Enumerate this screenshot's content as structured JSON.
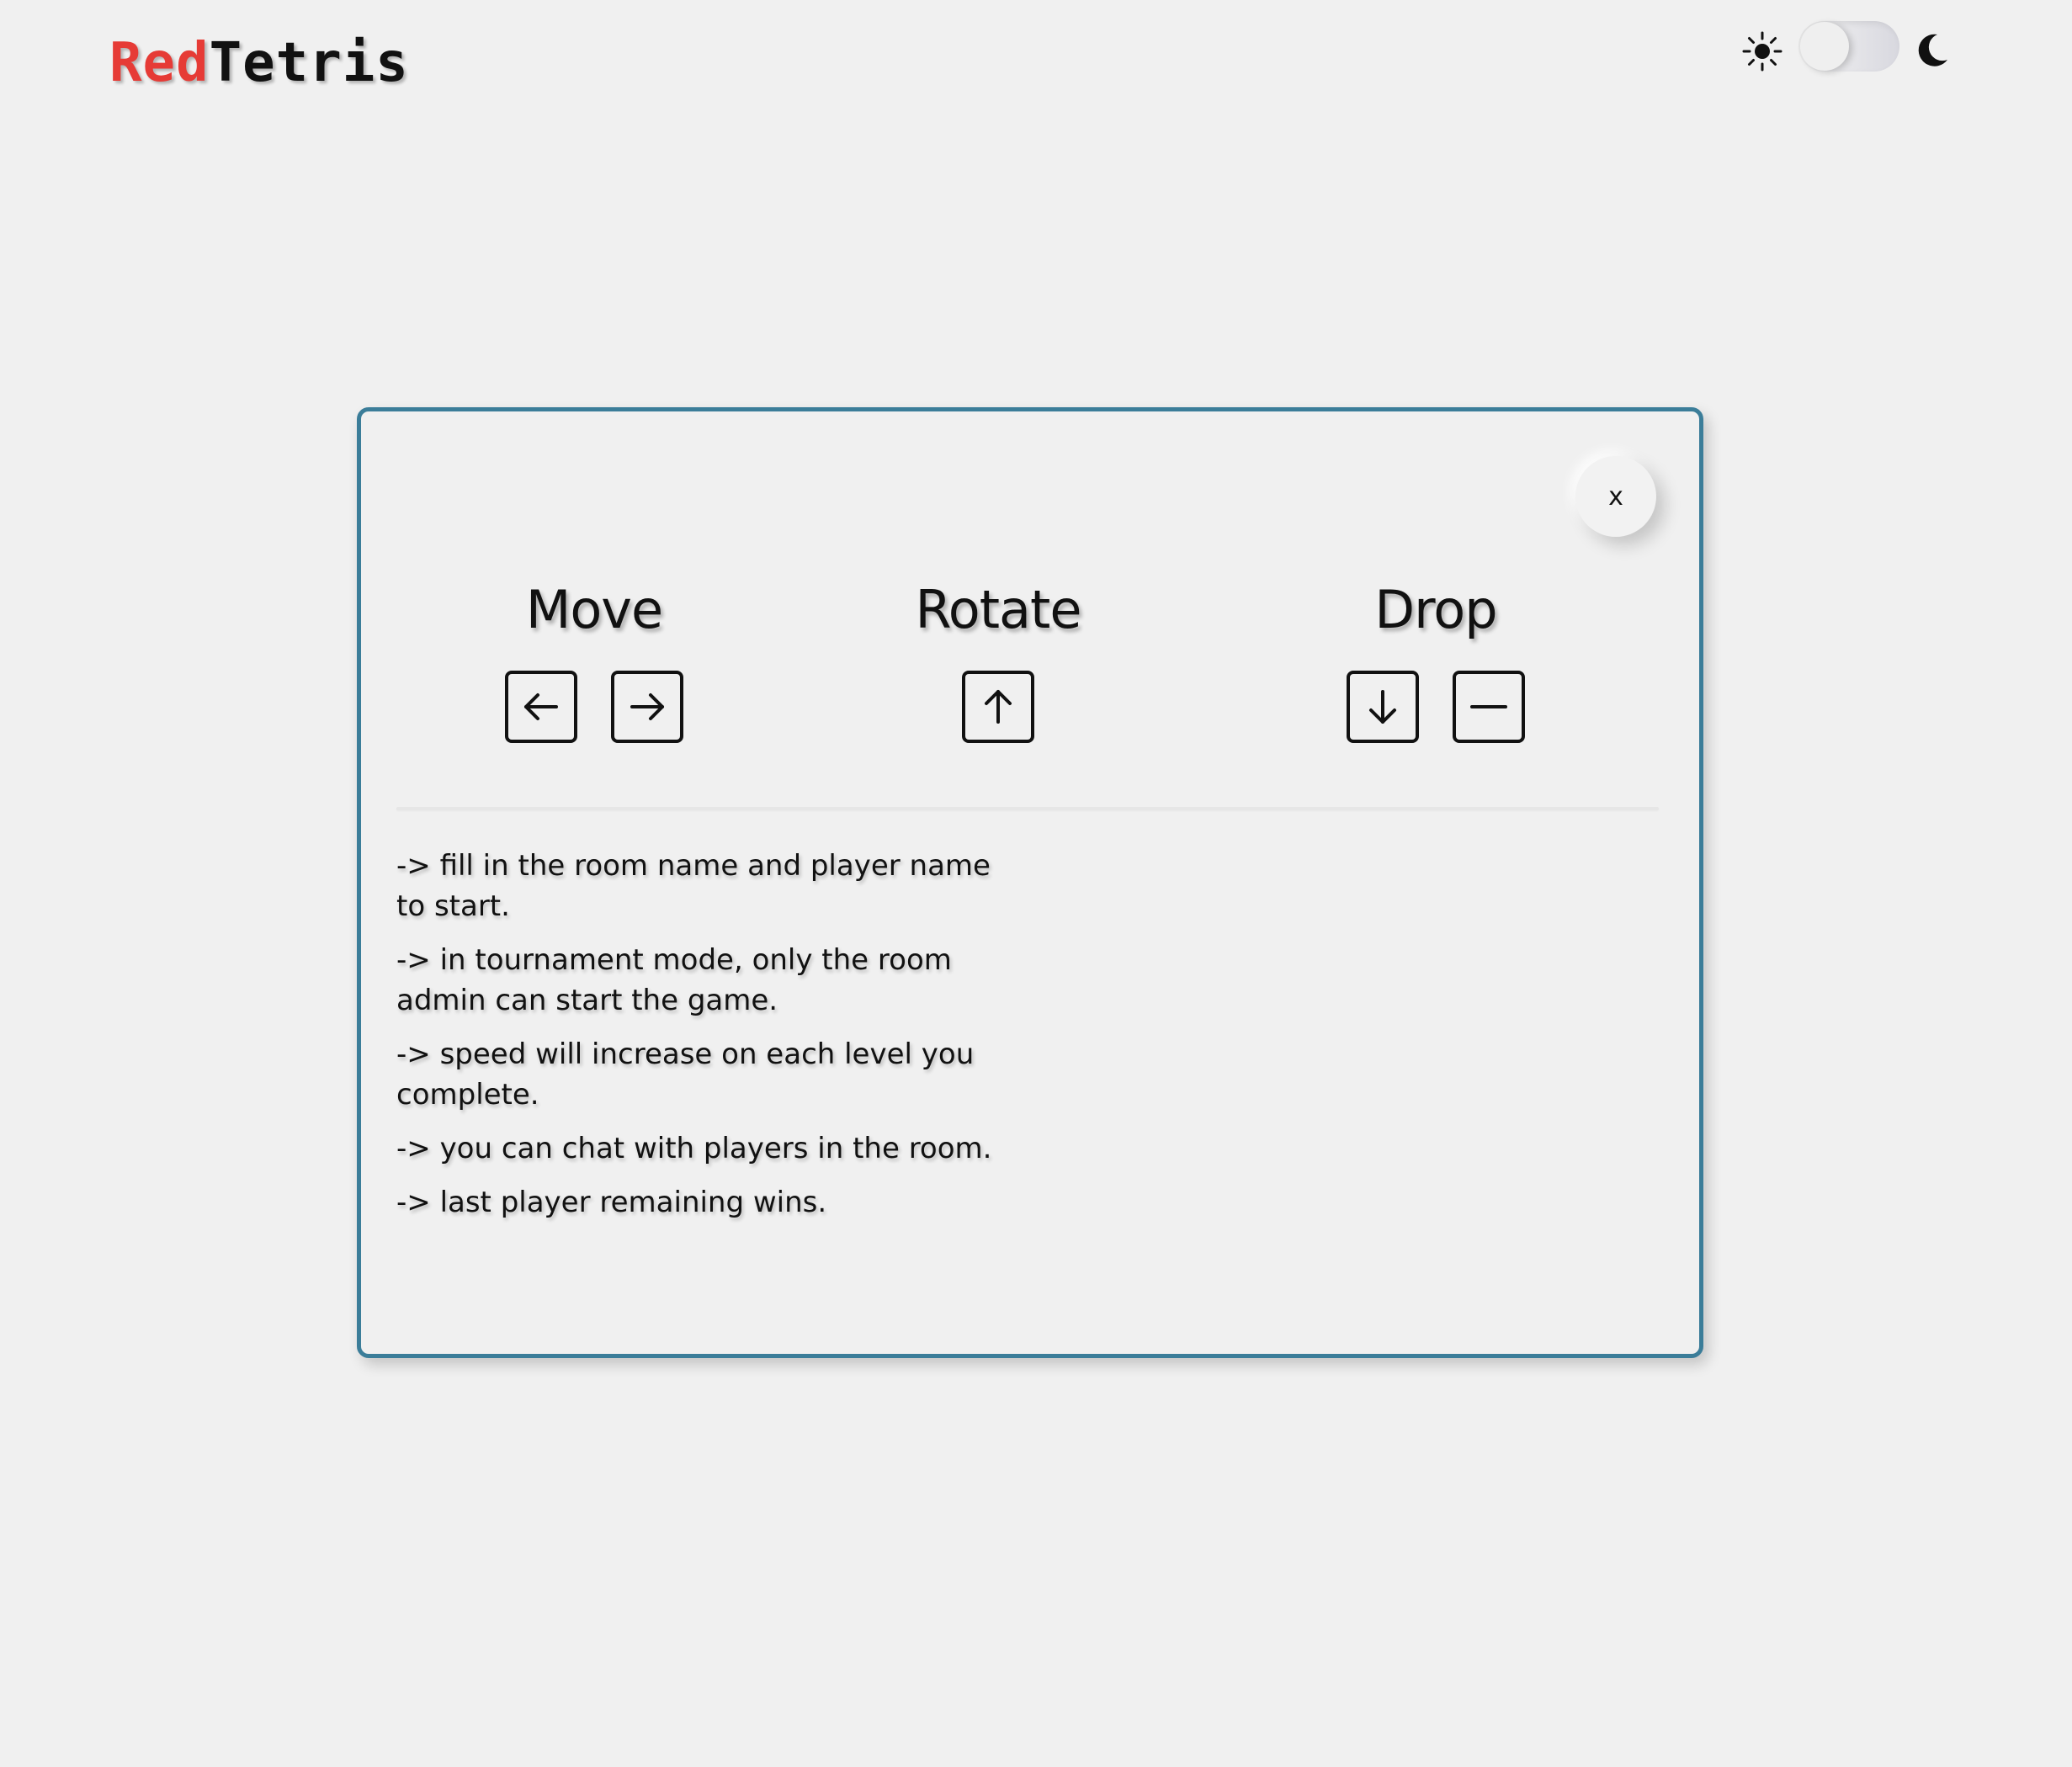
{
  "header": {
    "logo_part1": "Red",
    "logo_part2": "Tetris",
    "logo_colors": {
      "red": "#e63b36",
      "dark": "#111111"
    }
  },
  "theme_toggle": {
    "left_icon": "sun-icon",
    "right_icon": "moon-icon",
    "mode": "light"
  },
  "modal": {
    "close_label": "x",
    "border_color": "#3b7d99",
    "controls": [
      {
        "title": "Move",
        "keys": [
          "arrow-left-icon",
          "arrow-right-icon"
        ]
      },
      {
        "title": "Rotate",
        "keys": [
          "arrow-up-icon"
        ]
      },
      {
        "title": "Drop",
        "keys": [
          "arrow-down-icon",
          "space-bar-icon"
        ]
      }
    ],
    "rules": [
      "-> fill in the room name and player name to start.",
      "-> in tournament mode, only the room admin can start the game.",
      "-> speed will increase on each level you complete.",
      "-> you can chat with players in the room.",
      "-> last player remaining wins."
    ]
  }
}
